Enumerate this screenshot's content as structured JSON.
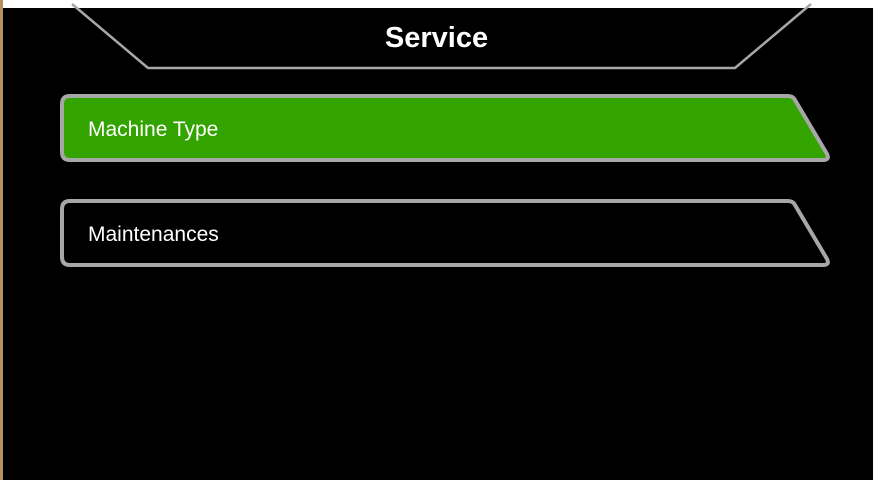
{
  "header": {
    "title": "Service"
  },
  "menu": {
    "items": [
      {
        "label": "Machine Type",
        "state": "selected",
        "fill": "#33a300"
      },
      {
        "label": "Maintenances",
        "state": "normal",
        "fill": "#000000"
      }
    ]
  },
  "colors": {
    "background": "#000000",
    "border": "#a7a7a7",
    "selected": "#33a300",
    "text": "#ffffff"
  }
}
